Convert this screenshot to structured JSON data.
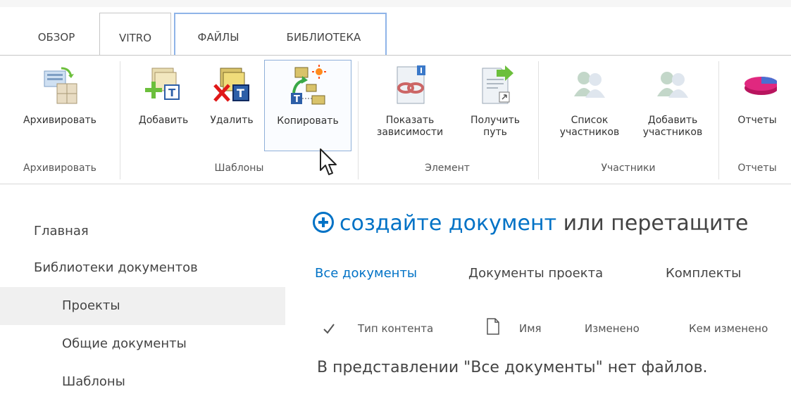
{
  "ribbon_tabs": [
    "ОБЗОР",
    "VITRO",
    "ФАЙЛЫ",
    "БИБЛИОТЕКА"
  ],
  "active_tab": "VITRO",
  "buttons": {
    "archive": "Архивировать",
    "add": "Добавить",
    "delete": "Удалить",
    "copy": "Копировать",
    "show_deps_1": "Показать",
    "show_deps_2": "зависимости",
    "get_path_1": "Получить",
    "get_path_2": "путь",
    "members_list_1": "Список",
    "members_list_2": "участников",
    "add_members_1": "Добавить",
    "add_members_2": "участников",
    "reports": "Отчеты"
  },
  "groups": {
    "archive": "Архивировать",
    "templates": "Шаблоны",
    "element": "Элемент",
    "members": "Участники",
    "reports": "Отчеты"
  },
  "nav": {
    "home": "Главная",
    "doc_libs": "Библиотеки документов",
    "projects": "Проекты",
    "shared_docs": "Общие документы",
    "templates": "Шаблоны"
  },
  "main": {
    "create_link": "создайте документ",
    "create_rest": " или перетащите",
    "views": [
      "Все документы",
      "Документы проекта",
      "Комплекты"
    ],
    "columns": {
      "content_type": "Тип контента",
      "name": "Имя",
      "modified": "Изменено",
      "modified_by": "Кем изменено"
    },
    "empty_message": "В представлении \"Все документы\" нет файлов."
  },
  "icons": {
    "archive": "archive-icon",
    "add": "add-template-icon",
    "delete": "delete-template-icon",
    "copy": "copy-template-icon",
    "deps": "dependencies-icon",
    "path": "get-path-icon",
    "members": "members-icon",
    "add_members": "add-members-icon",
    "reports": "reports-pie-icon",
    "check": "check-icon",
    "file": "file-icon",
    "create": "add-circle-icon",
    "cursor": "mouse-cursor-icon"
  },
  "colors": {
    "link": "#0072c6",
    "context_tab_border": "#8fb4e8",
    "selected_nav_bg": "#f0f0f0"
  }
}
